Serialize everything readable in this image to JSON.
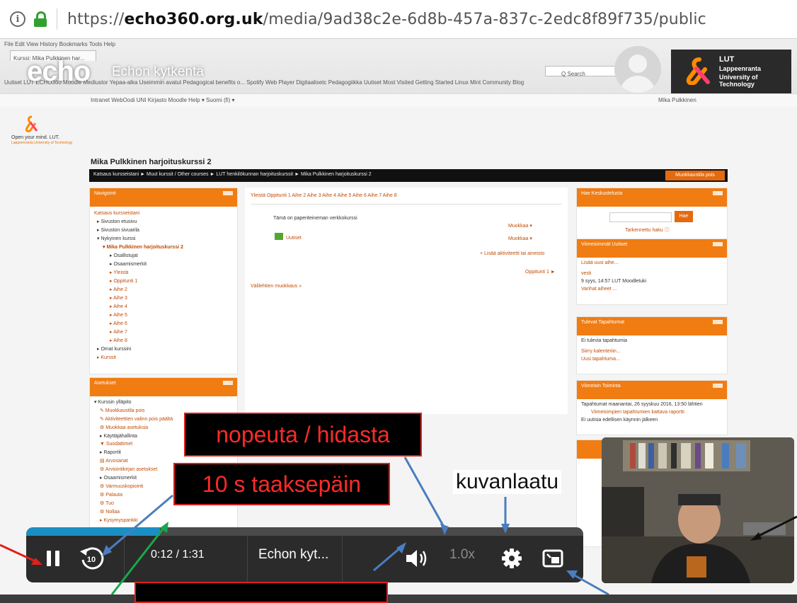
{
  "browser": {
    "url_domain": "echo360.org.uk",
    "url_path": "/media/9ad38c2e-6d8b-457a-837c-2edc8f89f735/public",
    "url_prefix": "https://"
  },
  "echo": {
    "logo": "echo",
    "title": "Echon kytkentä"
  },
  "lut": {
    "line1": "LUT",
    "line2": "Lappeenranta",
    "line3": "University of Technology",
    "small_slogan": "Open your mind. LUT.",
    "small_name": "Lappeenranta University of Technology"
  },
  "moodle": {
    "menu": "File  Edit  View  History  Bookmarks  Tools  Help",
    "tab": "Kurssi: Mika Pulkkinen har...",
    "search": "Q Search",
    "bookmarks": "Uutiset  LUT  ECHO360  Moodle  Mediustor  Yepaa-alka  Useimmin avatut  Pedagogical benefits o...  Spotify Web Player  Digitaalisetc  Pedagogiikka  Uutiset  Most Visited  Getting Started  Linux Mint  Community  Blog",
    "nav_links": "Intranet    WebOodi    UNI    Kirjasto    Moodle Help ▾    Suomi (fi) ▾",
    "user": "Mika Pulkkinen",
    "course_title": "Mika Pulkkinen harjoituskurssi 2",
    "breadcrumb": "Katsaus kursseistani  ►  Muut kurssit / Other courses  ►  LUT henkilökunnan harjoituskurssit  ►  Mika Pulkkinen harjoituskurssi 2",
    "edit_button": "Muokkaustila pois",
    "nav_block_title": "Navigointi",
    "nav_items": [
      "Katsaus kursseistani",
      "▸ Sivuston etusivu",
      "▸ Sivuston sivuarila",
      "▾ Nykyinen kurssi",
      "▾ Mika Pulkkinen harjoituskurssi 2",
      "▸ Osallistujat",
      "▸ Osaamismerkit",
      "▸ Yleistä",
      "▸ Oppitunti 1",
      "▸ Aihe 2",
      "▸ Aihe 3",
      "▸ Aihe 4",
      "▸ Aihe 5",
      "▸ Aihe 6",
      "▸ Aihe 7",
      "▸ Aihe 8",
      "▸ Omat kurssini",
      "▸ Kurssit"
    ],
    "settings_block_title": "Asetukset",
    "settings_items": [
      "▾ Kurssin ylläpito",
      "✎ Muokkaustila pois",
      "✎ Aktiviteettien valinn pois päältä",
      "⚙ Muokkaa asetuksia",
      "▸ Käyttäjähallinta",
      "▼ Suodattimet",
      "▸ Raportit",
      "▤ Arvosanat",
      "⚙ Arviointikirjan asetukset",
      "▸ Osaamismerkit",
      "⚙ Varmuuskopiointi",
      "⚙ Palauta",
      "⚙ Tuo",
      "⚙ Nollaa",
      "▸ Kysymyspankki"
    ],
    "tabs": "Yleistä    Oppitunti 1    Aihe 2    Aihe 3    Aihe 4    Aihe 5    Aihe 6    Aihe 7    Aihe 8",
    "center_intro": "Tämä on paperiteineman verkkokurssi",
    "center_edit1": "Muokkaa ▾",
    "center_edit2": "Muokkaa ▾",
    "center_news": "Uutiset",
    "center_add": "+ Lisää aktiviteetti tai aineisto",
    "center_next": "Oppitunti 1 ►",
    "center_bulk": "Välilehtien muokkaus »",
    "search_block_title": "Hae Keskustelusta",
    "search_btn": "Hae",
    "search_adv": "Tarkennettu haku ⓘ",
    "news_block_title": "Viimeisimmät Uutiset",
    "news_items": [
      "Lisää uusi aihe...",
      "vesti",
      "9 syys, 14:57 LUT Moodletuki",
      "Vanhat aiheet ..."
    ],
    "events_block_title": "Tulevat Tapahtumat",
    "events_items": [
      "Ei tulevia tapahtumia",
      "Siirry kalenteriin...",
      "Uusi tapahtuma..."
    ],
    "activity_block_title": "Viimeisin Toiminta",
    "activity_items": [
      "Tapahtumat maanantai, 26 syyskuu 2016, 13:50 lähtien",
      "Viimeisimpien tapahtumien kattava raportti",
      "Ei uutisia edellisen käynnin jälkeen"
    ]
  },
  "player": {
    "time": "0:12 / 1:31",
    "title": "Echon kyt...",
    "speed": "1.0x",
    "progress_fraction": 0.24
  },
  "annotations": {
    "speed": "nopeuta / hidasta",
    "rewind": "10 s taaksepäin",
    "quality": "kuvanlaatu"
  },
  "colors": {
    "moodle_orange": "#f07c12",
    "progress_blue": "#1b8fc4",
    "callout_red": "#ff2a2a",
    "lut_green": "#2fa12f"
  }
}
